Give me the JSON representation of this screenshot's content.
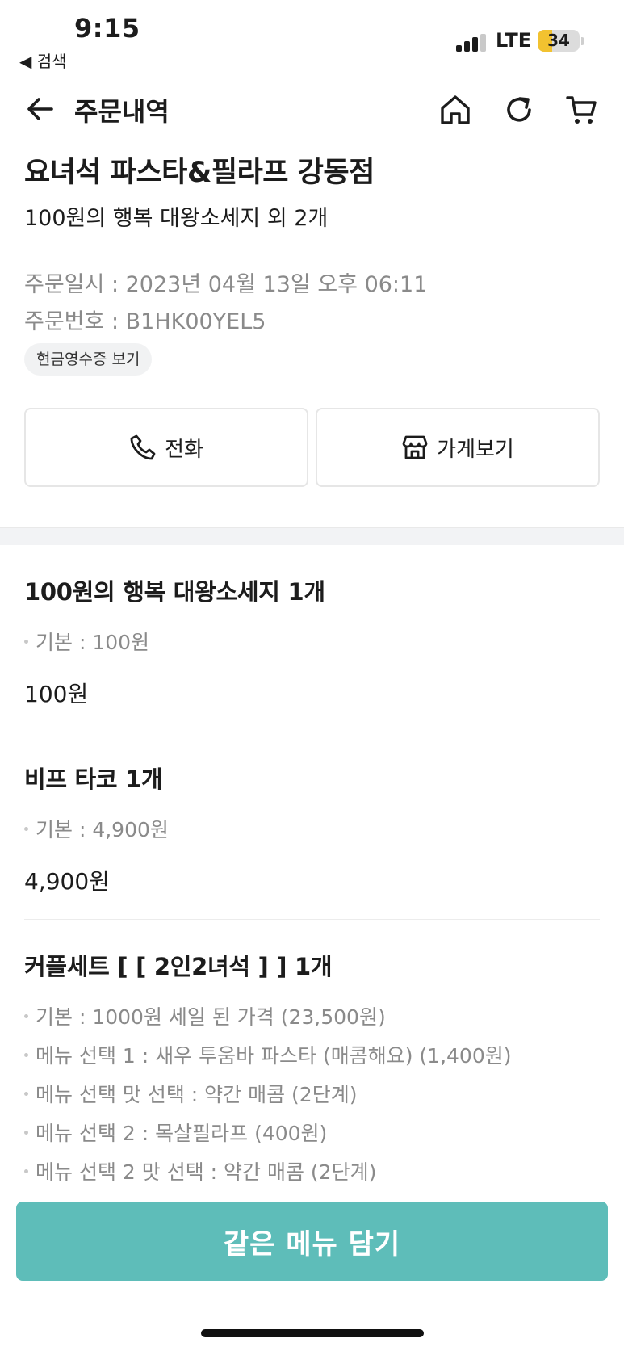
{
  "status_bar": {
    "time": "9:15",
    "back_app": "◀ 검색",
    "network": "LTE",
    "battery": "34",
    "battery_level_percent": 34
  },
  "nav": {
    "title": "주문내역",
    "icons": [
      "back-arrow-icon",
      "home-icon",
      "refresh-icon",
      "cart-icon"
    ]
  },
  "header": {
    "store_name": "요녀석 파스타&필라프 강동점",
    "summary": "100원의 행복 대왕소세지 외 2개",
    "order_datetime": "주문일시 : 2023년 04월 13일 오후 06:11",
    "order_number": "주문번호 : B1HK00YEL5",
    "receipt_label": "현금영수증 보기"
  },
  "actions": {
    "call_label": "전화",
    "store_label": "가게보기"
  },
  "items": [
    {
      "title": "100원의 행복 대왕소세지 1개",
      "options": [
        "기본 : 100원"
      ],
      "price": "100원"
    },
    {
      "title": "비프 타코 1개",
      "options": [
        "기본 : 4,900원"
      ],
      "price": "4,900원"
    },
    {
      "title": "커플세트 [ [ 2인2녀석 ] ] 1개",
      "options": [
        "기본 : 1000원 세일 된 가격 (23,500원)",
        "메뉴 선택 1 : 새우 투움바 파스타 (매콤해요) (1,400원)",
        "메뉴 선택 맛 선택 : 약간 매콤 (2단계)",
        "메뉴 선택 2 : 목살필라프 (400원)",
        "메뉴 선택 2 맛 선택 : 약간 매콤 (2단계)"
      ]
    }
  ],
  "cta_label": "같은 메뉴 담기",
  "colors": {
    "accent": "#5ebdb9",
    "battery": "#f2c230",
    "muted_text": "#8a8a8a"
  }
}
